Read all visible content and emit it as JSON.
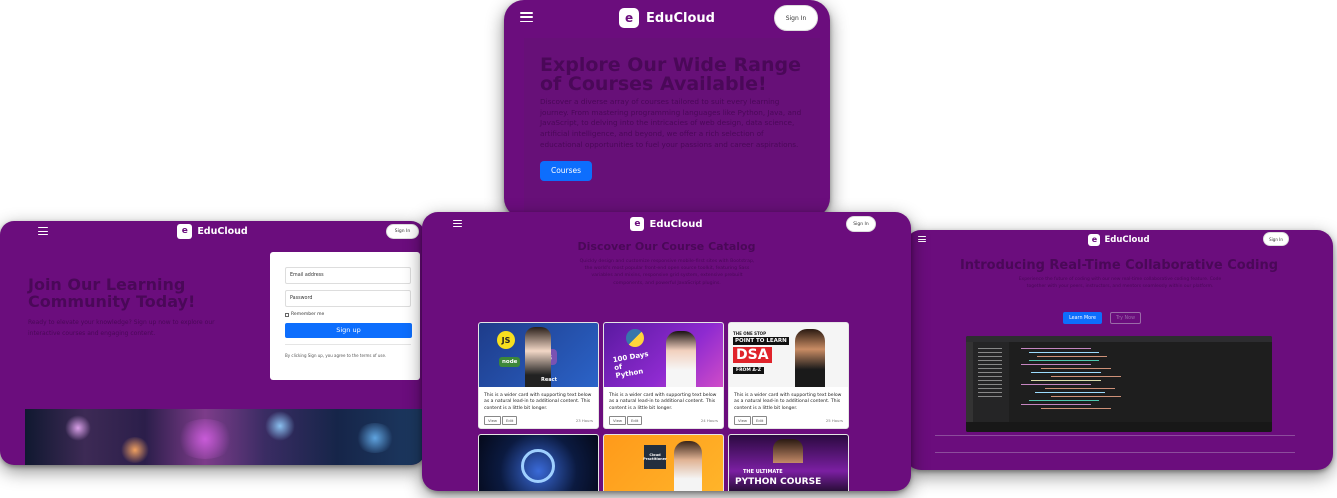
{
  "brand": {
    "name": "EduCloud",
    "logo_letter": "e",
    "signin_label": "Sign In"
  },
  "courses_page": {
    "heading": "Explore Our Wide Range of Courses Available!",
    "description": "Discover a diverse array of courses tailored to suit every learning journey. From mastering programming languages like Python, Java, and JavaScript, to delving into the intricacies of web design, data science, artificial intelligence, and beyond, we offer a rich selection of educational opportunities to fuel your passions and career aspirations.",
    "cta_label": "Courses"
  },
  "signup_page": {
    "heading": "Join Our Learning Community Today!",
    "description": "Ready to elevate your knowledge? Sign up now to explore our interactive courses and engaging content.",
    "email_placeholder": "Email address",
    "password_placeholder": "Password",
    "remember_label": "Remember me",
    "signup_label": "Sign up",
    "terms": "By clicking Sign up, you agree to the terms of use."
  },
  "catalog_page": {
    "heading": "Discover Our Course Catalog",
    "lead": "Quickly design and customize responsive mobile-first sites with Bootstrap, the world's most popular front-end open source toolkit, featuring Sass variables and mixins, responsive grid system, extensive prebuilt components, and powerful JavaScript plugins.",
    "card_text": "This is a wider card with supporting text below as a natural lead-in to additional content. This content is a little bit longer.",
    "view_label": "View",
    "edit_label": "Edit",
    "cards": [
      {
        "thumb": "JS · node · React · Bootstrap",
        "time": "23 Hours"
      },
      {
        "thumb": "100 Days of Python",
        "time": "24 Hours"
      },
      {
        "thumb": "THE ONE STOP POINT TO LEARN DSA FROM A-Z",
        "time": "25 Hours"
      }
    ],
    "bottom_cards": [
      {
        "thumb": "Unreal"
      },
      {
        "thumb": "Cloud Practitioner"
      },
      {
        "thumb": "THE ULTIMATE PYTHON COURSE"
      }
    ]
  },
  "collab_page": {
    "heading": "Introducing Real-Time Collaborative Coding",
    "lead": "Experience the future of coding with our new real-time collaborative coding feature. Code together with your peers, instructors, and mentors seamlessly within our platform.",
    "primary_label": "Learn More",
    "secondary_label": "Try Now"
  },
  "colors": {
    "page": "#6b0d7d",
    "heading": "#4a0858",
    "primary": "#0d6efd"
  }
}
